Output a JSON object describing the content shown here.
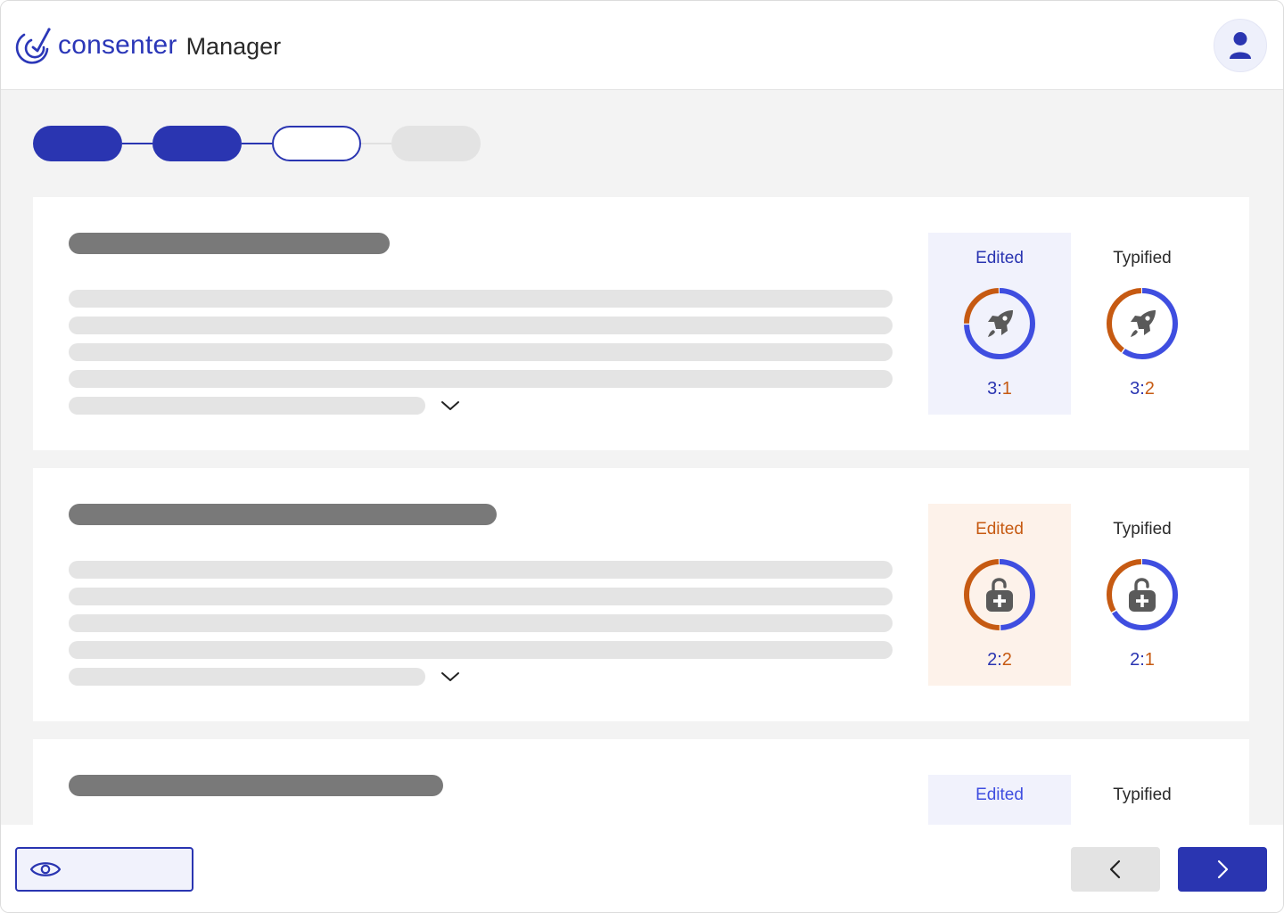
{
  "app": {
    "brand": "consenter",
    "product": "Manager",
    "brand_color": "#2b37b8"
  },
  "colors": {
    "primary": "#2a35b1",
    "accent_blue": "#3f4ee0",
    "accent_orange": "#c65a12",
    "skeleton_dark": "#797979",
    "skeleton_light": "#e4e4e4"
  },
  "stepper": {
    "steps": [
      {
        "state": "done"
      },
      {
        "state": "done"
      },
      {
        "state": "current"
      },
      {
        "state": "todo"
      }
    ]
  },
  "cards": [
    {
      "metrics": [
        {
          "label": "Edited",
          "highlighted": true,
          "tint": "blue",
          "icon": "rocket-icon",
          "ratio_left": "3",
          "ratio_sep": ":",
          "ratio_right": "1",
          "left_value": 3,
          "right_value": 1
        },
        {
          "label": "Typified",
          "highlighted": false,
          "tint": "none",
          "icon": "rocket-icon",
          "ratio_left": "3",
          "ratio_sep": ":",
          "ratio_right": "2",
          "left_value": 3,
          "right_value": 2
        }
      ]
    },
    {
      "metrics": [
        {
          "label": "Edited",
          "highlighted": true,
          "tint": "orange",
          "icon": "unlock-plus-icon",
          "ratio_left": "2",
          "ratio_sep": ":",
          "ratio_right": "2",
          "left_value": 2,
          "right_value": 2
        },
        {
          "label": "Typified",
          "highlighted": false,
          "tint": "none",
          "icon": "unlock-plus-icon",
          "ratio_left": "2",
          "ratio_sep": ":",
          "ratio_right": "1",
          "left_value": 2,
          "right_value": 1
        }
      ]
    },
    {
      "metrics": [
        {
          "label": "Edited",
          "highlighted": true,
          "tint": "blue"
        },
        {
          "label": "Typified",
          "highlighted": false,
          "tint": "none"
        }
      ]
    }
  ],
  "footer": {
    "preview_icon": "eye-icon",
    "prev_icon": "chevron-left-icon",
    "next_icon": "chevron-right-icon"
  }
}
